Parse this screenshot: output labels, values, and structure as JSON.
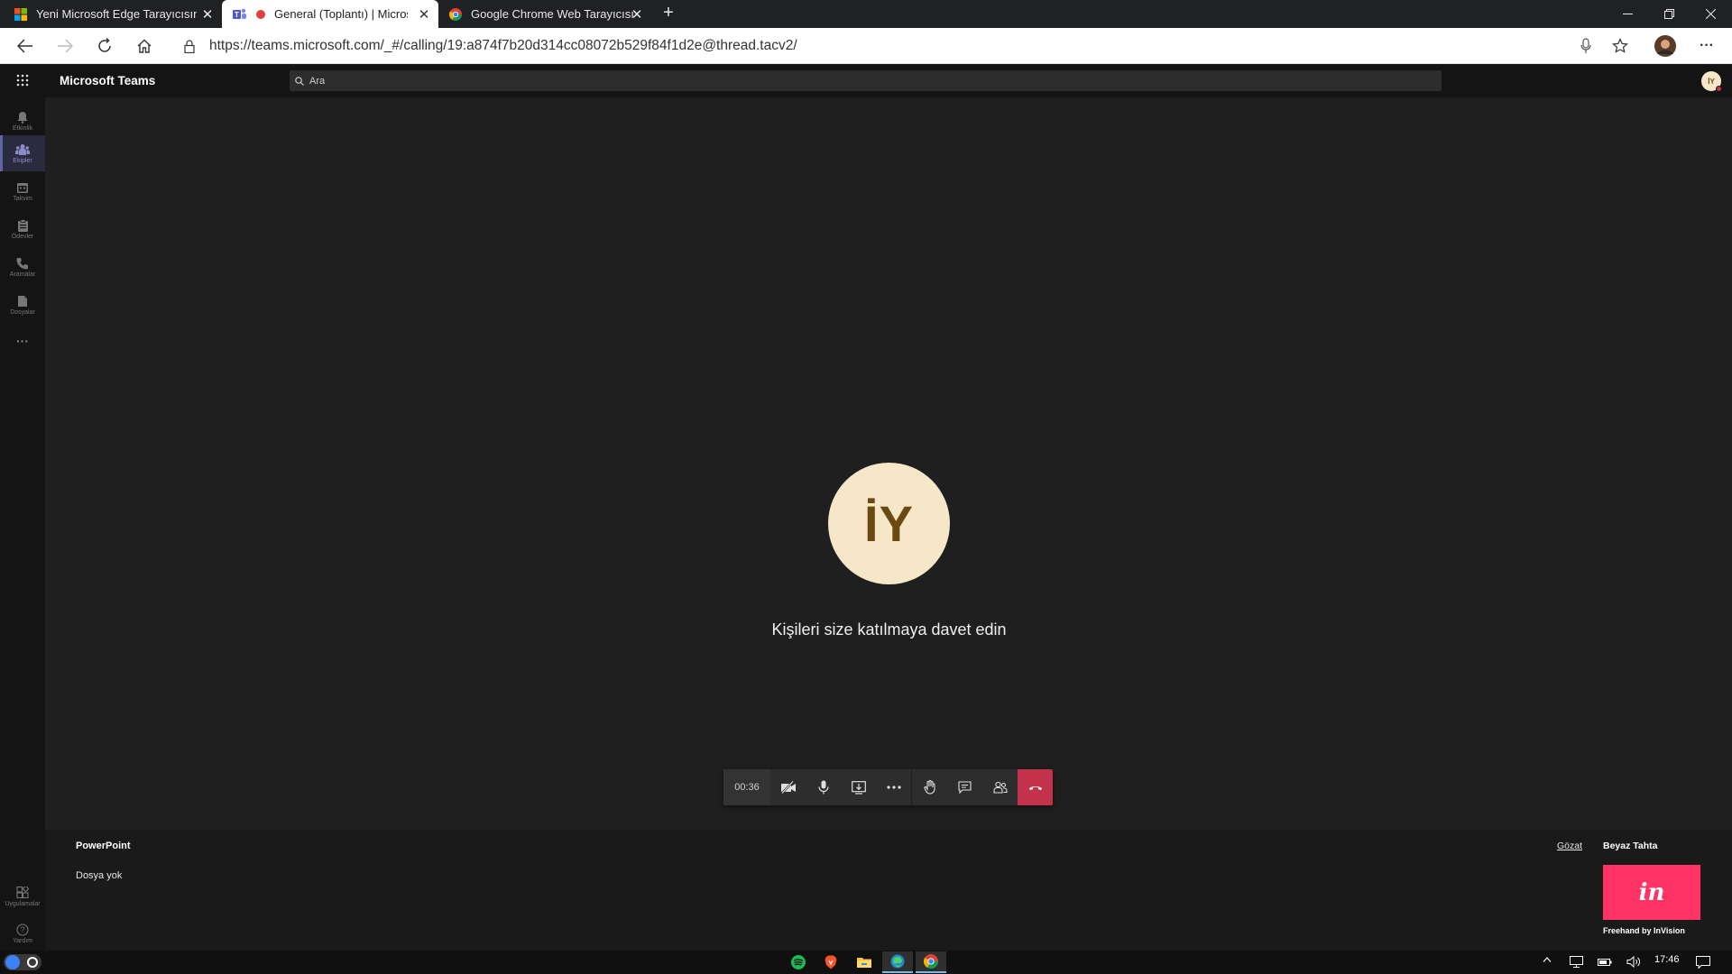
{
  "browser": {
    "tabs": [
      {
        "title": "Yeni Microsoft Edge Tarayıcısını İ",
        "close": "✕",
        "active": false
      },
      {
        "title": "General (Toplantı) | Microsof",
        "close": "✕",
        "active": true
      },
      {
        "title": "Google Chrome Web Tarayıcısı",
        "close": "✕",
        "active": false
      }
    ],
    "new_tab": "+",
    "url": "https://teams.microsoft.com/_#/calling/19:a874f7b20d314cc08072b529f84f1d2e@thread.tacv2/",
    "menu": "···"
  },
  "teams": {
    "app_title": "Microsoft Teams",
    "search_placeholder": "Ara",
    "profile_initials": "İY",
    "rail": [
      {
        "label": "Etkinlik",
        "icon": "bell-icon"
      },
      {
        "label": "Ekipler",
        "icon": "teams-icon",
        "active": true
      },
      {
        "label": "Takvim",
        "icon": "calendar-icon"
      },
      {
        "label": "Ödevler",
        "icon": "assignments-icon"
      },
      {
        "label": "Aramalar",
        "icon": "phone-icon"
      },
      {
        "label": "Dosyalar",
        "icon": "files-icon"
      }
    ],
    "rail_more": "···",
    "rail_bottom": [
      {
        "label": "Uygulamalar",
        "icon": "apps-icon"
      },
      {
        "label": "Yardım",
        "icon": "help-icon"
      }
    ]
  },
  "call": {
    "avatar_initials": "İY",
    "invite_text": "Kişileri size katılmaya davet edin",
    "timer": "00:36",
    "colors": {
      "hangup": "#c4314b",
      "avatar_bg": "#f6e7c9"
    }
  },
  "share_panel": {
    "powerpoint_label": "PowerPoint",
    "no_file": "Dosya yok",
    "browse": "Gözat",
    "whiteboard_label": "Beyaz Tahta",
    "whiteboard_tile_text": "in",
    "whiteboard_app_name": "Freehand by InVision"
  },
  "taskbar": {
    "time": "17:46"
  }
}
